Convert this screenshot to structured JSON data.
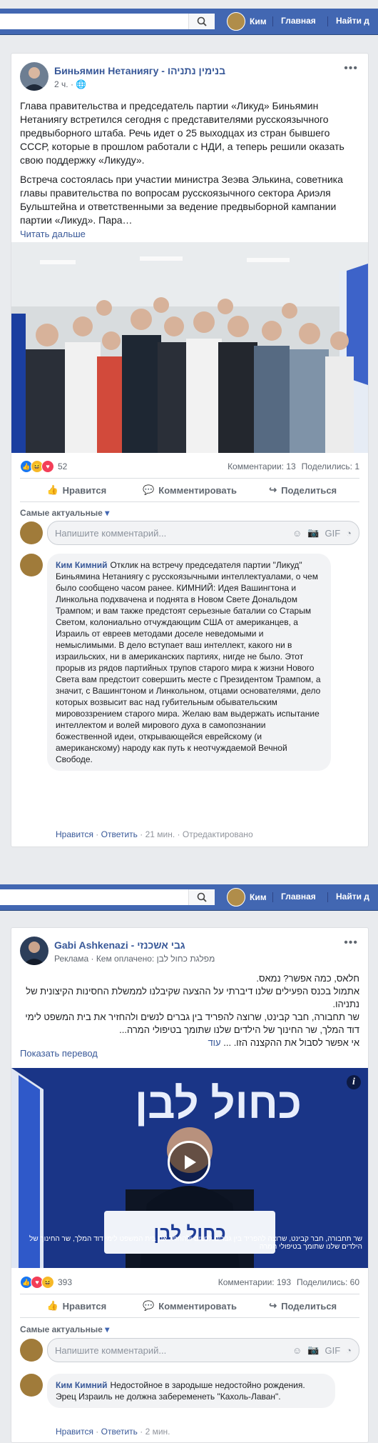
{
  "topbar": {
    "profile_name": "Ким",
    "nav_home": "Главная",
    "nav_find": "Найти д"
  },
  "post1": {
    "author": "Биньямин Нетаниягу - בנימין נתניהו",
    "time": "2 ч.",
    "paragraph1": "Глава правительства и председатель партии «Ликуд» Биньямин Нетаниягу встретился сегодня с представителями русскоязычного предвыборного штаба. Речь идет о 25 выходцах из стран бывшего СССР, которые в прошлом работали с НДИ, а теперь решили оказать свою поддержку «Ликуду».",
    "paragraph2": "Встреча состоялась при участии министра Зеэва Элькина, советника главы правительства по вопросам русскоязычного сектора Ариэля Бульштейна и ответственными за ведение предвыборной кампании партии «Ликуд». Пара…",
    "read_more": "Читать дальше",
    "reactions_count": "52",
    "comments": "Комментарии: 13",
    "shares": "Поделились: 1",
    "like": "Нравится",
    "comment": "Комментировать",
    "share": "Поделиться",
    "sort_label": "Самые актуальные",
    "input_placeholder": "Напишите комментарий...",
    "c_author": "Ким Кимний",
    "c_text": "Отклик на встречу председателя партии \"Ликуд\" Биньямина Нетаниягу с русскоязычными интеллектуалами, о чем было сообщено часом ранее. КИМНИЙ: Идея Вашингтона и Линкольна подхвачена и поднята в Новом Свете Дональдом Трампом; и вам также предстоят серьезные баталии со Старым Светом, колониально отчуждающим США от американцев, а Израиль от евреев методами доселе неведомыми и немыслимыми. В дело вступает ваш интеллект, какого ни в израильских, ни в американских партиях, нигде не было. Этот прорыв из рядов партийных трупов старого мира к жизни Нового Света вам предстоит совершить месте с Президентом Трампом, а значит, с Вашингтоном и Линкольном, отцами основателями, дело которых возвысит вас над губительным обывательским мировоззрением старого мира. Желаю вам выдержать испытание интеллектом и волей мирового духа в самопознании божественной идеи, открывающейся еврейскому (и американскому) народу как путь к неотчуждаемой Вечной Свободе.",
    "c_like": "Нравится",
    "c_reply": "Ответить",
    "c_time": "21 мин.",
    "c_edited": "Отредактировано"
  },
  "post2": {
    "author": "Gabi Ashkenazi - גבי אשכנזי",
    "sponsored": "Реклама",
    "paid_by": "Кем оплачено:",
    "paid_by_party": "מפלגת כחול לבן",
    "line1": "חלאס, כמה אפשר? נמאס.",
    "line2": "אתמול בכנס הפעילים שלנו דיברתי על ההצעה שקיבלנו לממשלת החסינות הקיצונית של נתניהו.",
    "line3": "שר תחבורה, חבר קבינט, שרוצה להפריד בין גברים לנשים ולהחזיר את בית המשפט לימי דוד המלך, שר החינוך של הילדים שלנו שתומך בטיפולי המרה...",
    "line4": "אי אפשר לסבול את ההקצנה הזו. ...",
    "more": "עוד",
    "translate": "Показать перевод",
    "video_caption": "שר תחבורה, חבר קבינט, שרוצה להפריד בין גברים לנשים ולהחזיר את בית המשפט לימי דוד המלך, שר החינוך של הילדים שלנו שתומך בטיפולי המרה",
    "reactions_count": "393",
    "comments": "Комментарии: 193",
    "shares": "Поделились: 60",
    "like": "Нравится",
    "comment": "Комментировать",
    "share": "Поделиться",
    "sort_label": "Самые актуальные",
    "input_placeholder": "Напишите комментарий...",
    "c_author": "Ким Кимний",
    "c_text": "Недостойное в зародыше недостойно рождения. Эрец Израиль не должна забеременеть \"Кахоль-Лаван\".",
    "c_like": "Нравится",
    "c_reply": "Ответить",
    "c_time": "2 мин."
  }
}
